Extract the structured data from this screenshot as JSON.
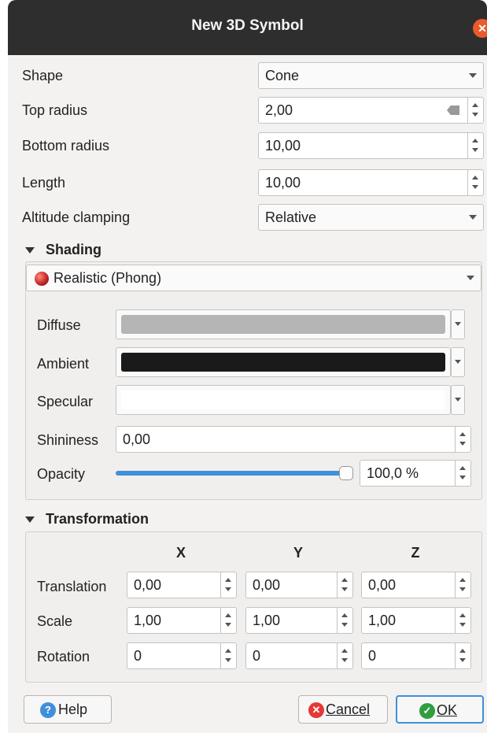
{
  "window": {
    "title": "New 3D Symbol"
  },
  "shape": {
    "label": "Shape",
    "value": "Cone"
  },
  "top_radius": {
    "label": "Top radius",
    "value": "2,00"
  },
  "bottom_radius": {
    "label": "Bottom radius",
    "value": "10,00"
  },
  "length": {
    "label": "Length",
    "value": "10,00"
  },
  "altitude_clamping": {
    "label": "Altitude clamping",
    "value": "Relative"
  },
  "shading": {
    "header": "Shading",
    "material": "Realistic (Phong)",
    "diffuse": {
      "label": "Diffuse",
      "color": "#b5b5b5"
    },
    "ambient": {
      "label": "Ambient",
      "color": "#1a1a1a"
    },
    "specular": {
      "label": "Specular",
      "color": "#ffffff"
    },
    "shininess": {
      "label": "Shininess",
      "value": "0,00"
    },
    "opacity": {
      "label": "Opacity",
      "value": "100,0 %",
      "level": 1.0
    }
  },
  "transformation": {
    "header": "Transformation",
    "axes": [
      "X",
      "Y",
      "Z"
    ],
    "rows": [
      {
        "label": "Translation",
        "values": [
          "0,00",
          "0,00",
          "0,00"
        ]
      },
      {
        "label": "Scale",
        "values": [
          "1,00",
          "1,00",
          "1,00"
        ]
      },
      {
        "label": "Rotation",
        "values": [
          "0",
          "0",
          "0"
        ]
      }
    ]
  },
  "buttons": {
    "help": "Help",
    "cancel": "Cancel",
    "ok": "OK"
  },
  "colors": {
    "accent": "#3f8fdb",
    "close": "#ea5a2b",
    "titlebar": "#2e2e2e"
  }
}
